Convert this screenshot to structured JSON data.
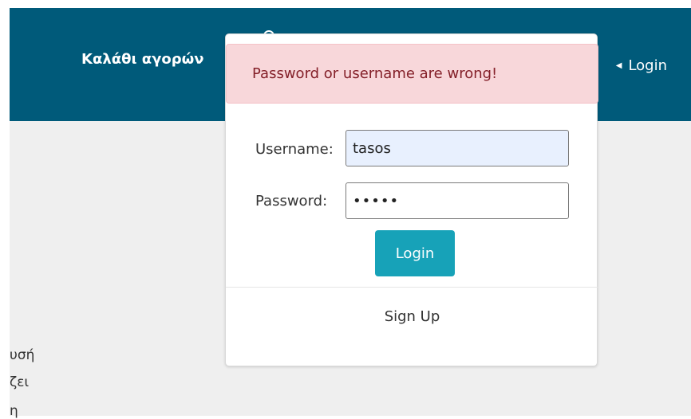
{
  "navbar": {
    "brand_label": "Καλάθι αγορών",
    "login_label": "Login"
  },
  "background_text": {
    "line1": "υσή",
    "line2": "ζει",
    "line3": "η"
  },
  "login_modal": {
    "alert_text": "Password or username are wrong!",
    "username_label": "Username:",
    "username_value": "tasos",
    "password_label": "Password:",
    "password_value": "•••••",
    "login_button_label": "Login",
    "signup_label": "Sign Up"
  },
  "colors": {
    "navbar": "#005a7a",
    "alert_bg": "#f8d7da",
    "alert_text": "#842029",
    "button": "#17a2b8",
    "autofill_bg": "#e8f0fe"
  }
}
